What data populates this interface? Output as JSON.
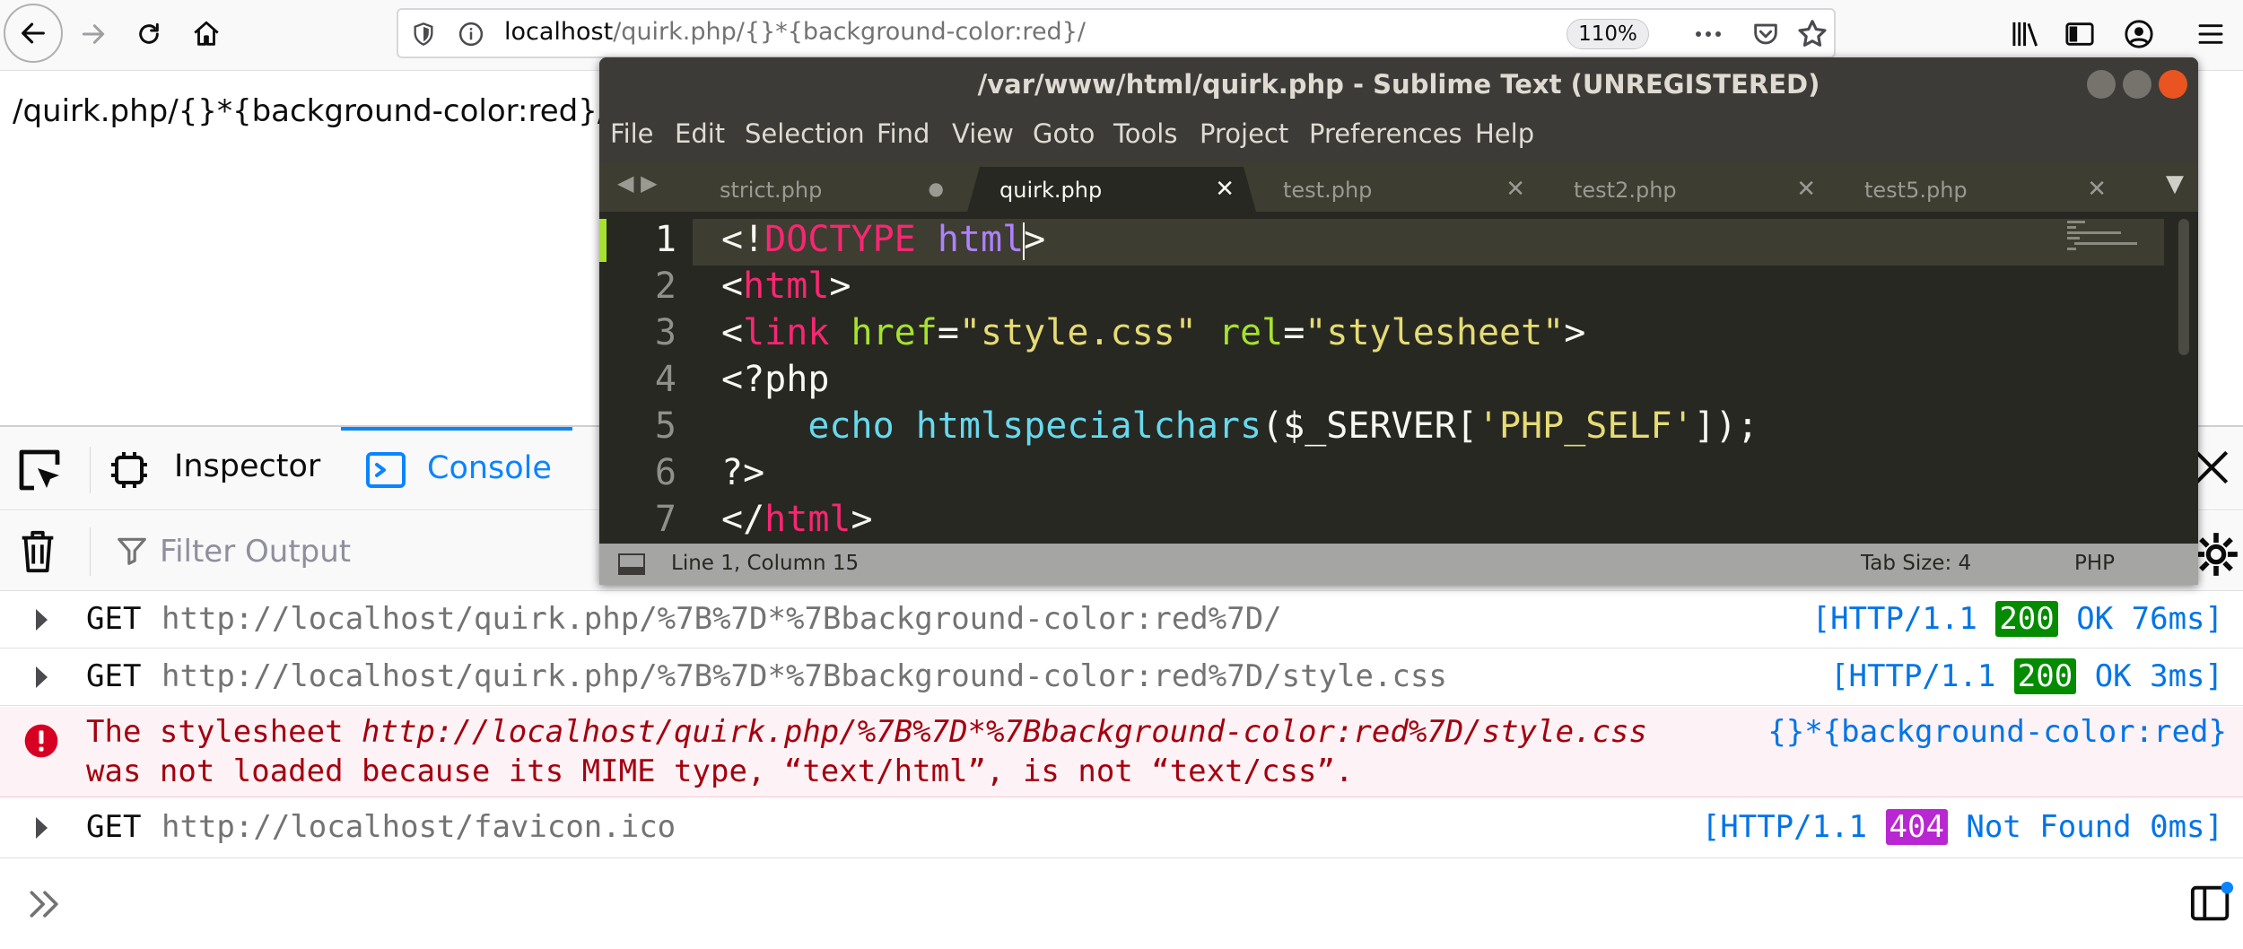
{
  "browser": {
    "url_host": "localhost",
    "url_path": "/quirk.php/{}*{background-color:red}/",
    "zoom": "110%"
  },
  "page": {
    "text": "/quirk.php/{}*{background-color:red}/"
  },
  "devtools": {
    "tabs": [
      {
        "label": "Inspector"
      },
      {
        "label": "Console",
        "active": true
      }
    ],
    "filter_placeholder": "Filter Output",
    "log": [
      {
        "method": "GET",
        "url": "http://localhost/quirk.php/%7B%7D*%7Bbackground-color:red%7D/",
        "proto": "[HTTP/1.1",
        "code": "200",
        "status": "OK 76ms]"
      },
      {
        "method": "GET",
        "url": "http://localhost/quirk.php/%7B%7D*%7Bbackground-color:red%7D/style.css",
        "proto": "[HTTP/1.1",
        "code": "200",
        "status": "OK 3ms]"
      },
      {
        "method": "GET",
        "url": "http://localhost/favicon.ico",
        "proto": "[HTTP/1.1",
        "code": "404",
        "status": "Not Found 0ms]"
      }
    ],
    "error": {
      "prefix": "The stylesheet ",
      "url": "http://localhost/quirk.php/%7B%7D*%7Bbackground-color:red%7D/style.css",
      "line2": "was not loaded because its MIME type, “text/html”, is not “text/css”.",
      "source": "{}*{background-color:red}"
    }
  },
  "sublime": {
    "title": "/var/www/html/quirk.php - Sublime Text (UNREGISTERED)",
    "menu": [
      "File",
      "Edit",
      "Selection",
      "Find",
      "View",
      "Goto",
      "Tools",
      "Project",
      "Preferences",
      "Help"
    ],
    "tabs": [
      {
        "name": "strict.php",
        "modified": true
      },
      {
        "name": "quirk.php",
        "active": true
      },
      {
        "name": "test.php"
      },
      {
        "name": "test2.php"
      },
      {
        "name": "test5.php"
      }
    ],
    "line_numbers": [
      "1",
      "2",
      "3",
      "4",
      "5",
      "6",
      "7"
    ],
    "status": {
      "position": "Line 1, Column 15",
      "tab_size": "Tab Size: 4",
      "syntax": "PHP"
    }
  },
  "colors": {
    "accent": "#0a84ff",
    "error_text": "#a4000f",
    "status_200": "#058b00",
    "status_404": "#b827d1",
    "editor_bg": "#272822"
  }
}
